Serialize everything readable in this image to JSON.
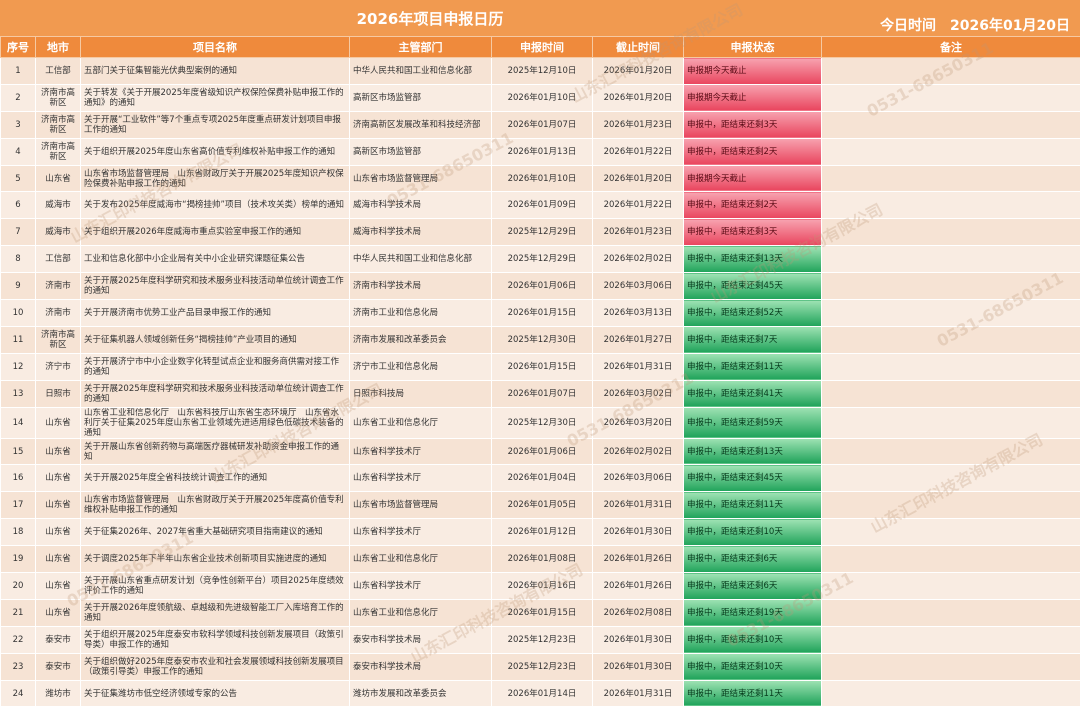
{
  "title": "2026年项目申报日历",
  "today": "今日时间　2026年01月20日",
  "headers": [
    "序号",
    "地市",
    "项目名称",
    "主管部门",
    "申报时间",
    "截止时间",
    "申报状态",
    "备注"
  ],
  "rows": [
    {
      "no": "1",
      "city": "工信部",
      "name": "五部门关于征集智能光伏典型案例的通知",
      "dept": "中华人民共和国工业和信息化部",
      "start": "2025年12月10日",
      "end": "2026年01月20日",
      "status": "申报期今天截止",
      "color": "red",
      "note": ""
    },
    {
      "no": "2",
      "city": "济南市高新区",
      "name": "关于转发《关于开展2025年度省级知识产权保险保费补贴申报工作的通知》的通知",
      "dept": "高新区市场监管部",
      "start": "2026年01月10日",
      "end": "2026年01月20日",
      "status": "申报期今天截止",
      "color": "red",
      "note": ""
    },
    {
      "no": "3",
      "city": "济南市高新区",
      "name": "关于开展“工业软件”等7个重点专项2025年度重点研发计划项目申报工作的通知",
      "dept": "济南高新区发展改革和科技经济部",
      "start": "2026年01月07日",
      "end": "2026年01月23日",
      "status": "申报中，距结束还剩3天",
      "color": "red",
      "note": ""
    },
    {
      "no": "4",
      "city": "济南市高新区",
      "name": "关于组织开展2025年度山东省高价值专利维权补贴申报工作的通知",
      "dept": "高新区市场监管部",
      "start": "2026年01月13日",
      "end": "2026年01月22日",
      "status": "申报中，距结束还剩2天",
      "color": "red",
      "note": ""
    },
    {
      "no": "5",
      "city": "山东省",
      "name": "山东省市场监督管理局　山东省财政厅关于开展2025年度知识产权保险保费补贴申报工作的通知",
      "dept": "山东省市场监督管理局",
      "start": "2026年01月10日",
      "end": "2026年01月20日",
      "status": "申报期今天截止",
      "color": "red",
      "note": ""
    },
    {
      "no": "6",
      "city": "威海市",
      "name": "关于发布2025年度威海市“揭榜挂帅”项目（技术攻关类）榜单的通知",
      "dept": "威海市科学技术局",
      "start": "2026年01月09日",
      "end": "2026年01月22日",
      "status": "申报中，距结束还剩2天",
      "color": "red",
      "note": ""
    },
    {
      "no": "7",
      "city": "威海市",
      "name": "关于组织开展2026年度威海市重点实验室申报工作的通知",
      "dept": "威海市科学技术局",
      "start": "2025年12月29日",
      "end": "2026年01月23日",
      "status": "申报中，距结束还剩3天",
      "color": "red",
      "note": ""
    },
    {
      "no": "8",
      "city": "工信部",
      "name": "工业和信息化部中小企业局有关中小企业研究课题征集公告",
      "dept": "中华人民共和国工业和信息化部",
      "start": "2025年12月29日",
      "end": "2026年02月02日",
      "status": "申报中，距结束还剩13天",
      "color": "green",
      "note": ""
    },
    {
      "no": "9",
      "city": "济南市",
      "name": "关于开展2025年度科学研究和技术服务业科技活动单位统计调查工作的通知",
      "dept": "济南市科学技术局",
      "start": "2026年01月06日",
      "end": "2026年03月06日",
      "status": "申报中，距结束还剩45天",
      "color": "green",
      "note": ""
    },
    {
      "no": "10",
      "city": "济南市",
      "name": "关于开展济南市优势工业产品目录申报工作的通知",
      "dept": "济南市工业和信息化局",
      "start": "2026年01月15日",
      "end": "2026年03月13日",
      "status": "申报中，距结束还剩52天",
      "color": "green",
      "note": ""
    },
    {
      "no": "11",
      "city": "济南市高新区",
      "name": "关于征集机器人领域创新任务“揭榜挂帅”产业项目的通知",
      "dept": "济南市发展和改革委员会",
      "start": "2025年12月30日",
      "end": "2026年01月27日",
      "status": "申报中，距结束还剩7天",
      "color": "green",
      "note": ""
    },
    {
      "no": "12",
      "city": "济宁市",
      "name": "关于开展济宁市中小企业数字化转型试点企业和服务商供需对接工作的通知",
      "dept": "济宁市工业和信息化局",
      "start": "2026年01月15日",
      "end": "2026年01月31日",
      "status": "申报中，距结束还剩11天",
      "color": "green",
      "note": ""
    },
    {
      "no": "13",
      "city": "日照市",
      "name": "关于开展2025年度科学研究和技术服务业科技活动单位统计调查工作的通知",
      "dept": "日照市科技局",
      "start": "2026年01月07日",
      "end": "2026年03月02日",
      "status": "申报中，距结束还剩41天",
      "color": "green",
      "note": ""
    },
    {
      "no": "14",
      "city": "山东省",
      "name": "山东省工业和信息化厅　山东省科技厅山东省生态环境厅　山东省水利厅关于征集2025年度山东省工业领域先进适用绿色低碳技术装备的通知",
      "dept": "山东省工业和信息化厅",
      "start": "2025年12月30日",
      "end": "2026年03月20日",
      "status": "申报中，距结束还剩59天",
      "color": "green",
      "note": ""
    },
    {
      "no": "15",
      "city": "山东省",
      "name": "关于开展山东省创新药物与高端医疗器械研发补助资金申报工作的通知",
      "dept": "山东省科学技术厅",
      "start": "2026年01月06日",
      "end": "2026年02月02日",
      "status": "申报中，距结束还剩13天",
      "color": "green",
      "note": ""
    },
    {
      "no": "16",
      "city": "山东省",
      "name": "关于开展2025年度全省科技统计调查工作的通知",
      "dept": "山东省科学技术厅",
      "start": "2026年01月04日",
      "end": "2026年03月06日",
      "status": "申报中，距结束还剩45天",
      "color": "green",
      "note": ""
    },
    {
      "no": "17",
      "city": "山东省",
      "name": "山东省市场监督管理局　山东省财政厅关于开展2025年度高价值专利维权补贴申报工作的通知",
      "dept": "山东省市场监督管理局",
      "start": "2026年01月05日",
      "end": "2026年01月31日",
      "status": "申报中，距结束还剩11天",
      "color": "green",
      "note": ""
    },
    {
      "no": "18",
      "city": "山东省",
      "name": "关于征集2026年、2027年省重大基础研究项目指南建议的通知",
      "dept": "山东省科学技术厅",
      "start": "2026年01月12日",
      "end": "2026年01月30日",
      "status": "申报中，距结束还剩10天",
      "color": "green",
      "note": ""
    },
    {
      "no": "19",
      "city": "山东省",
      "name": "关于调度2025年下半年山东省企业技术创新项目实施进度的通知",
      "dept": "山东省工业和信息化厅",
      "start": "2026年01月08日",
      "end": "2026年01月26日",
      "status": "申报中，距结束还剩6天",
      "color": "green",
      "note": ""
    },
    {
      "no": "20",
      "city": "山东省",
      "name": "关于开展山东省重点研发计划（竞争性创新平台）项目2025年度绩效评价工作的通知",
      "dept": "山东省科学技术厅",
      "start": "2026年01月16日",
      "end": "2026年01月26日",
      "status": "申报中，距结束还剩6天",
      "color": "green",
      "note": ""
    },
    {
      "no": "21",
      "city": "山东省",
      "name": "关于开展2026年度领航级、卓越级和先进级智能工厂入库培育工作的通知",
      "dept": "山东省工业和信息化厅",
      "start": "2026年01月15日",
      "end": "2026年02月08日",
      "status": "申报中，距结束还剩19天",
      "color": "green",
      "note": ""
    },
    {
      "no": "22",
      "city": "泰安市",
      "name": "关于组织开展2025年度泰安市软科学领域科技创新发展项目（政策引导类）申报工作的通知",
      "dept": "泰安市科学技术局",
      "start": "2025年12月23日",
      "end": "2026年01月30日",
      "status": "申报中，距结束还剩10天",
      "color": "green",
      "note": ""
    },
    {
      "no": "23",
      "city": "泰安市",
      "name": "关于组织做好2025年度泰安市农业和社会发展领域科技创新发展项目（政策引导类）申报工作的通知",
      "dept": "泰安市科学技术局",
      "start": "2025年12月23日",
      "end": "2026年01月30日",
      "status": "申报中，距结束还剩10天",
      "color": "green",
      "note": ""
    },
    {
      "no": "24",
      "city": "潍坊市",
      "name": "关于征集潍坊市低空经济领域专家的公告",
      "dept": "潍坊市发展和改革委员会",
      "start": "2026年01月14日",
      "end": "2026年01月31日",
      "status": "申报中，距结束还剩11天",
      "color": "green",
      "note": ""
    }
  ],
  "watermarks": [
    "山东汇印科技咨询有限公司",
    "0531-68650311"
  ]
}
